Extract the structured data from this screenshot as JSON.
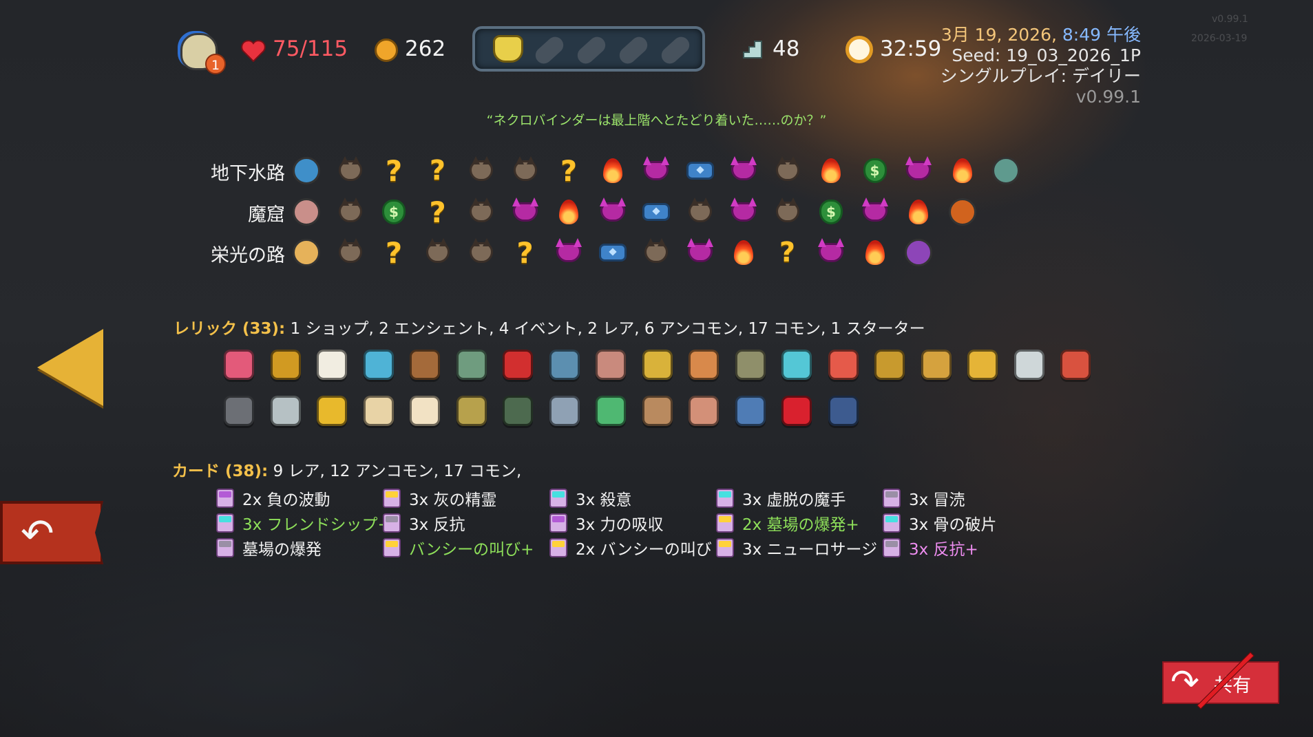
{
  "hud": {
    "ascension": "1",
    "hp": "75/115",
    "gold": "262",
    "floor": "48",
    "timer": "32:59",
    "colors": {
      "hp": "#ff5a63",
      "gold_icon": "#f0a52a",
      "potion_frame": "#5a6e80"
    }
  },
  "run_info": {
    "date": "3月 19, 2026,",
    "time": "8:49 午後",
    "seed": "Seed: 19_03_2026_1P",
    "mode": "シングルプレイ: デイリー",
    "version": "v0.99.1",
    "faint_version": "v0.99.1",
    "faint_date": "2026-03-19"
  },
  "quote": "“ネクロバインダーは最上階へとたどり着いた……のか？”",
  "paths": [
    {
      "label": "地下水路",
      "nodes": [
        "boss-sewer",
        "mob",
        "question",
        "question-horn",
        "mob",
        "mob",
        "question",
        "fire",
        "elite",
        "chest",
        "elite",
        "mob",
        "fire",
        "bag",
        "elite",
        "fire",
        "boss-end-sewer"
      ]
    },
    {
      "label": "魔窟",
      "nodes": [
        "boss-hive",
        "mob",
        "bag",
        "question",
        "mob",
        "elite",
        "fire",
        "elite",
        "chest",
        "mob",
        "elite",
        "mob",
        "bag",
        "elite",
        "fire",
        "boss-end-hive"
      ]
    },
    {
      "label": "栄光の路",
      "nodes": [
        "boss-glory",
        "mob",
        "question",
        "mob",
        "mob",
        "question",
        "elite",
        "chest",
        "mob",
        "elite",
        "fire",
        "question-horn",
        "elite",
        "fire",
        "boss-end-glory"
      ]
    }
  ],
  "relics": {
    "title": "レリック (33):",
    "summary": "1 ショップ,  2 エンシェント, 4 イベント, 2 レア, 6 アンコモン, 17 コモン, 1 スターター",
    "row1": [
      "heart-relic",
      "ring-relic",
      "cheese-relic",
      "ticket-relic",
      "stump-relic",
      "kettle-relic",
      "potion-relic",
      "anvil-relic",
      "leaf-relic",
      "vajra-relic",
      "bone-relic",
      "cradle-relic",
      "gem-relic",
      "scroll-relic",
      "quill-relic",
      "flower-pot-relic",
      "feather-relic",
      "wing-relic",
      "lipstick-relic"
    ],
    "row2": [
      "cleaver-relic",
      "stone-relic",
      "banana-relic",
      "daisy-relic",
      "cream-relic",
      "mango-relic",
      "lantern-relic",
      "cloak-relic",
      "bracelet-relic",
      "backpack-relic",
      "meat-relic",
      "sleeping-bag-relic",
      "strawberry-relic",
      "whetstone-relic"
    ],
    "colors": [
      "#e35a7a",
      "#d19a22",
      "#f1ede1",
      "#4fb3d6",
      "#a46a3a",
      "#6f9c7f",
      "#d22f2f",
      "#5c8fb0",
      "#c98a7d",
      "#d9b23a",
      "#d8894b",
      "#8f8f6a",
      "#54c7d6",
      "#e55a4a",
      "#c89a2e",
      "#d5a23e",
      "#e5b437",
      "#cfd7d9",
      "#d9523f",
      "#6c6f75",
      "#b6c1c4",
      "#e8b92c",
      "#e8d3a6",
      "#f2e2c4",
      "#b7a14c",
      "#4d6a4f",
      "#8fa1b4",
      "#4fb872",
      "#b98a5f",
      "#d39078",
      "#4f7cb5",
      "#d9212e",
      "#3d5b8f"
    ]
  },
  "cards": {
    "title": "カード (38):",
    "summary": "9 レア, 12 アンコモン, 17 コモン,",
    "columns": [
      [
        {
          "text": "2x 負の波動",
          "icon": "purple",
          "style": ""
        },
        {
          "text": "3x フレンドシップ+",
          "icon": "cyan",
          "style": "up"
        },
        {
          "text": "墓場の爆発",
          "icon": "gray",
          "style": ""
        }
      ],
      [
        {
          "text": "3x 灰の精霊",
          "icon": "yellow",
          "style": ""
        },
        {
          "text": "3x 反抗",
          "icon": "gray",
          "style": ""
        },
        {
          "text": "バンシーの叫び+",
          "icon": "yellow",
          "style": "up"
        }
      ],
      [
        {
          "text": "3x 殺意",
          "icon": "cyan",
          "style": ""
        },
        {
          "text": "3x 力の吸収",
          "icon": "purple",
          "style": ""
        },
        {
          "text": "2x バンシーの叫び",
          "icon": "yellow",
          "style": ""
        }
      ],
      [
        {
          "text": "3x 虚脱の魔手",
          "icon": "cyan",
          "style": ""
        },
        {
          "text": "2x 墓場の爆発+",
          "icon": "yellow",
          "style": "up"
        },
        {
          "text": "3x ニューロサージ",
          "icon": "yellow",
          "style": ""
        }
      ],
      [
        {
          "text": "3x 冒涜",
          "icon": "gray",
          "style": ""
        },
        {
          "text": "3x 骨の破片",
          "icon": "cyan",
          "style": ""
        },
        {
          "text": "3x 反抗+",
          "icon": "gray",
          "style": "pinkup"
        }
      ]
    ]
  },
  "buttons": {
    "share": "共有"
  }
}
